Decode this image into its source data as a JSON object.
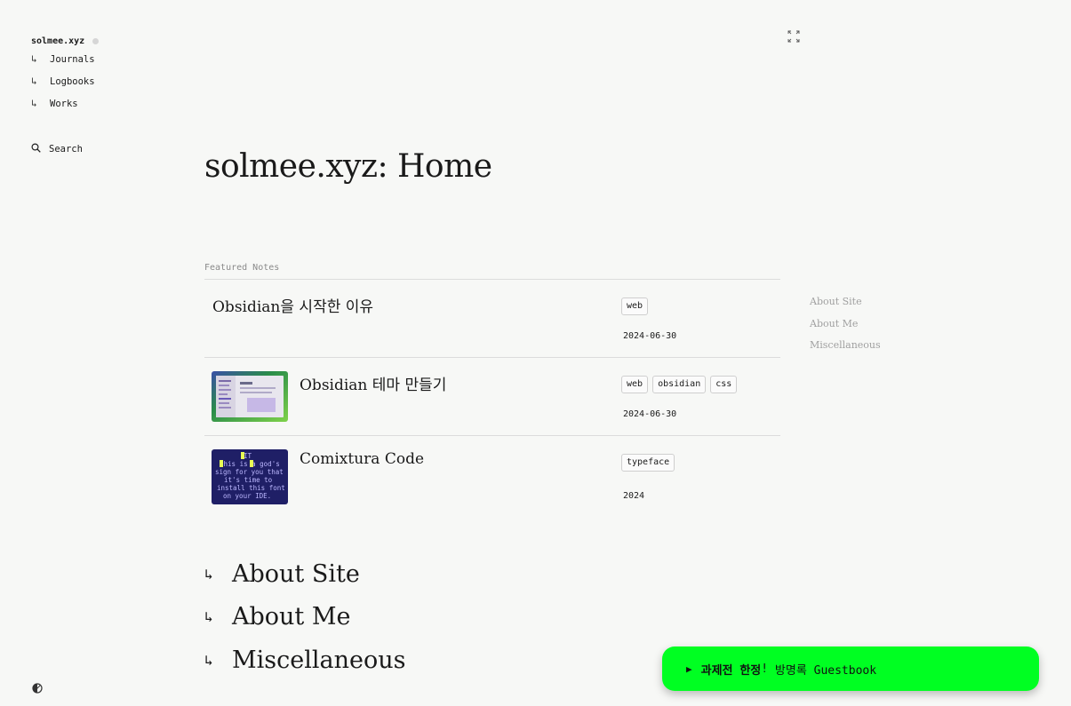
{
  "sidebar": {
    "site_title": "solmee.xyz",
    "nav_arrow": "↳",
    "items": [
      {
        "label": "Journals"
      },
      {
        "label": "Logbooks"
      },
      {
        "label": "Works"
      }
    ],
    "search_label": "Search"
  },
  "icons": {
    "status_dot": "status-dot-icon",
    "expand": "expand-icon",
    "search": "search-icon",
    "theme": "theme-toggle-icon"
  },
  "main": {
    "title": "solmee.xyz: Home",
    "featured_label": "Featured Notes",
    "notes": [
      {
        "title": "Obsidian을 시작한 이유",
        "tags": [
          "web"
        ],
        "date": "2024-06-30",
        "thumbnail": false
      },
      {
        "title": "Obsidian 테마 만들기",
        "tags": [
          "web",
          "obsidian",
          "css"
        ],
        "date": "2024-06-30",
        "thumbnail": true
      },
      {
        "title": "Comixtura Code",
        "tags": [
          "typeface"
        ],
        "date": "2024",
        "thumbnail": true
      }
    ],
    "bottom_links": [
      {
        "arrow": "↳",
        "label": "About Site"
      },
      {
        "arrow": "↳",
        "label": "About Me"
      },
      {
        "arrow": "↳",
        "label": "Miscellaneous"
      }
    ]
  },
  "toc": {
    "items": [
      "About Site",
      "About Me",
      "Miscellaneous"
    ]
  },
  "guestbook": {
    "play": "▶",
    "strong_text": "과제전 한정",
    "exclaim": "!",
    "rest_text": " 방명록 Guestbook"
  },
  "colors": {
    "background": "#f7f8f6",
    "guestbook_green": "#00ff22",
    "muted": "#a0a0a0"
  }
}
